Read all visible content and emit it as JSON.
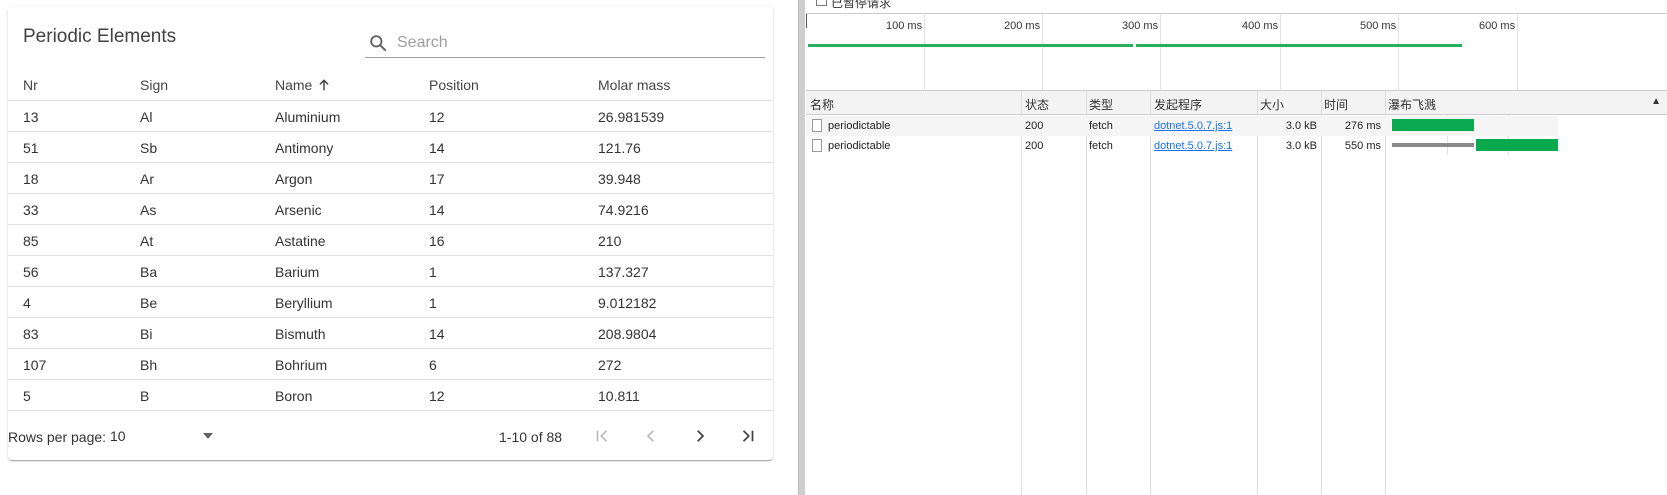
{
  "table": {
    "title": "Periodic Elements",
    "search_placeholder": "Search",
    "columns": [
      "Nr",
      "Sign",
      "Name",
      "Position",
      "Molar mass"
    ],
    "sort_icon": "arrow-up-icon",
    "rows": [
      [
        "13",
        "Al",
        "Aluminium",
        "12",
        "26.981539"
      ],
      [
        "51",
        "Sb",
        "Antimony",
        "14",
        "121.76"
      ],
      [
        "18",
        "Ar",
        "Argon",
        "17",
        "39.948"
      ],
      [
        "33",
        "As",
        "Arsenic",
        "14",
        "74.9216"
      ],
      [
        "85",
        "At",
        "Astatine",
        "16",
        "210"
      ],
      [
        "56",
        "Ba",
        "Barium",
        "1",
        "137.327"
      ],
      [
        "4",
        "Be",
        "Beryllium",
        "1",
        "9.012182"
      ],
      [
        "83",
        "Bi",
        "Bismuth",
        "14",
        "208.9804"
      ],
      [
        "107",
        "Bh",
        "Bohrium",
        "6",
        "272"
      ],
      [
        "5",
        "B",
        "Boron",
        "12",
        "10.811"
      ]
    ],
    "pager": {
      "rows_per_page_label": "Rows per page:",
      "rows_per_page_value": "10",
      "range": "1-10 of 88"
    }
  },
  "devtools": {
    "top_label": "已暂停请求",
    "ticks": [
      "100 ms",
      "200 ms",
      "300 ms",
      "400 ms",
      "500 ms",
      "600 ms"
    ],
    "headers": [
      "名称",
      "状态",
      "类型",
      "发起程序",
      "大小",
      "时间",
      "瀑布飞溅"
    ],
    "sort_indicator": "▲",
    "requests": [
      {
        "name": "periodictable",
        "status": "200",
        "type": "fetch",
        "initiator": "dotnet.5.0.7.js:1",
        "size": "3.0 kB",
        "time": "276 ms",
        "waiting_fraction": 0.0,
        "download_fraction": 0.5
      },
      {
        "name": "periodictable",
        "status": "200",
        "type": "fetch",
        "initiator": "dotnet.5.0.7.js:1",
        "size": "3.0 kB",
        "time": "550 ms",
        "waiting_fraction": 0.5,
        "download_fraction": 0.5
      }
    ],
    "colors": {
      "download": "#0aa84f",
      "waiting": "#8a8a8a",
      "overview_line": "#27ae60"
    }
  }
}
